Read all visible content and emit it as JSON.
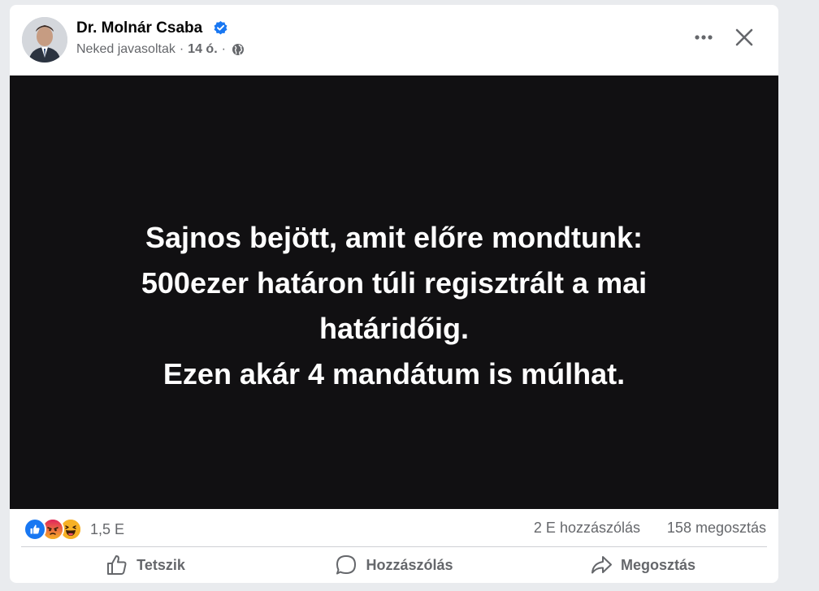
{
  "post": {
    "author": "Dr. Molnár Csaba",
    "suggestion_label": "Neked javasoltak",
    "separator": "·",
    "time": "14 ó.",
    "image_text": "Sajnos bejött, amit előre mondtunk:\n500ezer határon túli regisztrált a mai határidőig.\nEzen akár 4 mandátum is múlhat."
  },
  "icons": {
    "verified": "verified-badge-icon",
    "audience": "globe-icon",
    "more": "more-options-icon",
    "close": "close-icon",
    "reactions": [
      "like-icon",
      "angry-icon",
      "haha-icon"
    ],
    "actions": [
      "thumbs-up-icon",
      "comment-bubble-icon",
      "share-arrow-icon"
    ]
  },
  "stats": {
    "reactions_count": "1,5 E",
    "comments": "2 E hozzászólás",
    "shares": "158 megosztás"
  },
  "actions": {
    "like": "Tetszik",
    "comment": "Hozzászólás",
    "share": "Megosztás"
  },
  "colors": {
    "verified": "#1877f2",
    "like": "#1877f2",
    "angry": "#e9710f",
    "haha": "#f7b125",
    "image_background": "#111012"
  }
}
